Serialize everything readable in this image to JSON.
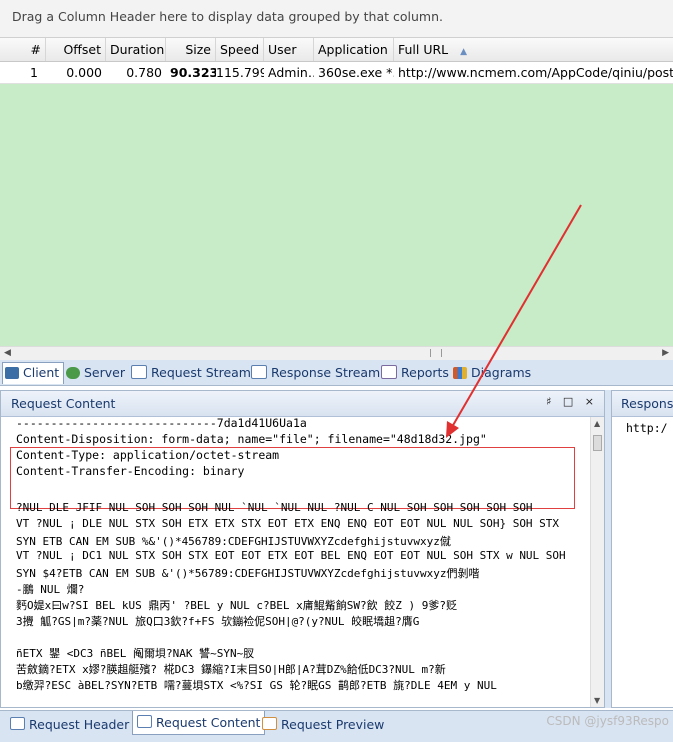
{
  "groupbar": {
    "text": "Drag a Column Header here to display data grouped by that column."
  },
  "columns": [
    "#",
    "Offset",
    "Duration",
    "Size",
    "Speed",
    "User",
    "Application",
    "Full URL"
  ],
  "sort_indicator": "▲",
  "row": {
    "num": "1",
    "offset": "0.000",
    "duration": "0.780",
    "size": "90.323",
    "speed": "115.799",
    "user": "Admin…",
    "application": "360se.exe *…",
    "url": "http://www.ncmem.com/AppCode/qiniu/post_or"
  },
  "tabs": [
    {
      "label": "Client",
      "icon": "client-icon",
      "color": "#3a6ea5"
    },
    {
      "label": "Server",
      "icon": "server-icon",
      "color": "#4a9a4a"
    },
    {
      "label": "Request Stream",
      "icon": "request-stream-icon",
      "color": "#5a7fb0"
    },
    {
      "label": "Response Stream",
      "icon": "response-stream-icon",
      "color": "#5a7fb0"
    },
    {
      "label": "Reports",
      "icon": "reports-icon",
      "color": "#7a6aa0"
    },
    {
      "label": "Diagrams",
      "icon": "diagrams-icon",
      "color": "#d05a2a"
    }
  ],
  "request_pane": {
    "title": "Request Content",
    "buttons": "♯ □ ×",
    "lines": [
      "-----------------------------7da1d41U6Ua1a",
      "Content-Disposition: form-data; name=\"file\"; filename=\"48d18d32.jpg\"",
      "Content-Type: application/octet-stream",
      "Content-Transfer-Encoding: binary"
    ],
    "binary_lines": [
      "  ?NUL DLE JFIF NUL SOH SOH SOH NUL `NUL `NUL NUL  ?NUL C NUL SOH SOH SOH SOH SOH",
      "VT  ?NUL ¡ DLE NUL STX SOH ETX ETX STX EOT ETX ENQ ENQ EOT EOT NUL NUL SOH} SOH STX",
      "SYN ETB CAN EM SUB %&'()*456789:CDEFGHIJSTUVWXYZcdefghijstuvwxyz僦",
      "VT  ?NUL ¡ DC1 NUL STX SOH STX EOT EOT ETX EOT BEL ENQ EOT EOT NUL SOH STX w NUL SOH",
      "SYN $4?ETB CAN EM SUB &'()*56789:CDEFGHIJSTUVWXYZcdefghijstuvwxyz們剝喈",
      "-鵬     NUL 爛?",
      "麫O媞x曰w?SI BEL kUS 鼎丙'  ?BEL y NUL c?BEL x庯鯤觜餉SW?飲 餃Z  )   9爹?贬",
      "3攪     觚?GS|m?薬?NUL 旅Q口3欽?f+FS 欤鏰裣伲SOH|@?(y?NUL 皎眠墧趄?膺G",
      "",
      "ñETX 鑍   <DC3 ñBEL 阄爾垻?NAK 讐~SYN~肞",
      "苦斂鏑?ETX x嫪?朠趄艇殯?  椛DC3 鑤縮?I末目SO|H郎|A?茸DZ%餄低DC3?NUL m?新",
      "b缴羿?ESC àBEL?SYN?ETB 嚅?蔓垻STX <%?SI GS 轮?眠GS 鹋郎?ETB 旐?DLE 4EM y  NUL"
    ]
  },
  "response_pane": {
    "title": "Respons",
    "url": "http:/"
  },
  "bottom_tabs": [
    {
      "label": "Request Header",
      "icon": "request-header-icon"
    },
    {
      "label": "Request Content",
      "icon": "request-content-icon"
    },
    {
      "label": "Request Preview",
      "icon": "request-preview-icon"
    }
  ],
  "watermark": "CSDN @jysf93Respo"
}
